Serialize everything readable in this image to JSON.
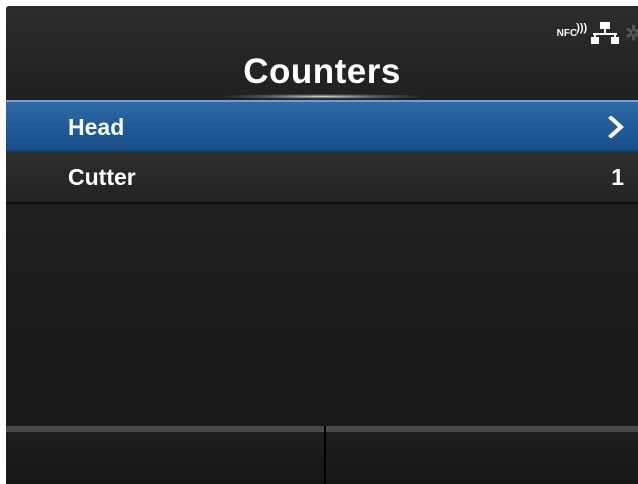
{
  "header": {
    "title": "Counters",
    "status_icons": [
      "nfc-icon",
      "network-icon",
      "bluetooth-icon"
    ],
    "nfc_label": "NFC"
  },
  "menu": {
    "items": [
      {
        "label": "Head",
        "value": "",
        "has_chevron": true,
        "selected": true
      },
      {
        "label": "Cutter",
        "value": "1",
        "has_chevron": false,
        "selected": false
      }
    ]
  },
  "colors": {
    "selected_row": "#1f5a98",
    "background": "#1c1c1c",
    "text": "#ffffff"
  }
}
